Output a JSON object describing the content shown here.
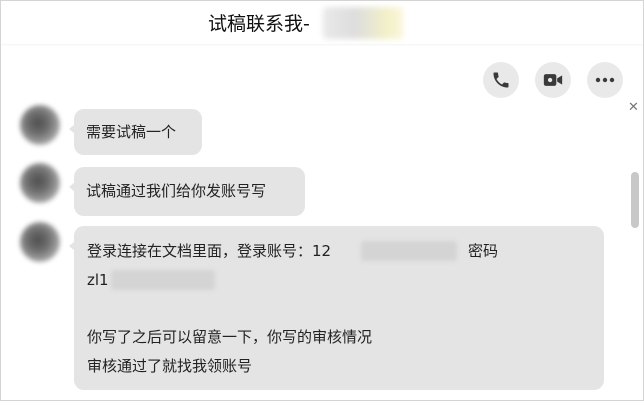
{
  "header": {
    "title": "试稿联系我-",
    "actions": [
      {
        "name": "phone-call",
        "icon": "phone-icon"
      },
      {
        "name": "video-call",
        "icon": "video-camera-icon"
      },
      {
        "name": "more",
        "icon": "more-horizontal-icon"
      }
    ]
  },
  "messages": [
    {
      "text": "需要试稿一个"
    },
    {
      "text": "试稿通过我们给你发账号写"
    },
    {
      "lines": [
        "登录连接在文档里面，登录账号：12",
        "密码",
        "zl1",
        "你写了之后可以留意一下，你写的审核情况",
        "审核通过了就找我领账号"
      ]
    }
  ],
  "colors": {
    "bubble": "#e4e4e4",
    "action_button": "#e9e9e9",
    "icon": "#3a3a3a"
  }
}
